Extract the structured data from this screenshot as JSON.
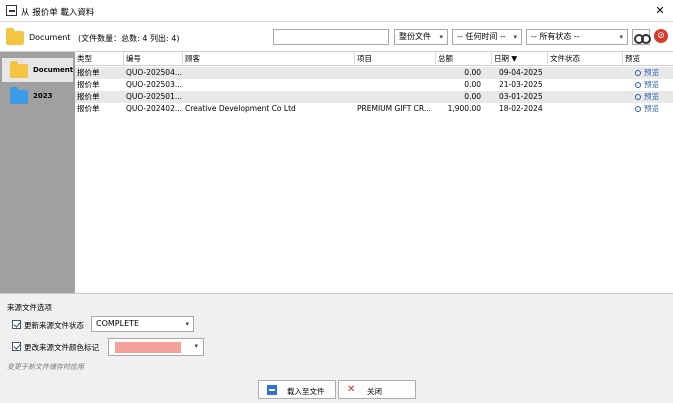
{
  "window": {
    "title": "从 报价单 載入資料",
    "close": "✕"
  },
  "toolbar": {
    "folder_label": "Document",
    "count_text": "(文件数量：总数: 4  列出: 4)",
    "search_value": "",
    "filter_type": "整份文件",
    "filter_time": "-- 任何时间 --",
    "filter_status": "-- 所有状态 --",
    "clear_label": "⊘"
  },
  "sidebar": {
    "items": [
      {
        "label": "Document"
      },
      {
        "label": "2023"
      }
    ]
  },
  "table": {
    "headers": [
      "类型",
      "编号",
      "顾客",
      "项目",
      "总额",
      "日期 ▼",
      "文件状态",
      "预览"
    ],
    "rows": [
      [
        "报价单",
        "QUO-202504...",
        "",
        "",
        "0.00",
        "09-04-2025",
        "",
        "预览"
      ],
      [
        "报价单",
        "QUO-202503...",
        "",
        "",
        "0.00",
        "21-03-2025",
        "",
        "预览"
      ],
      [
        "报价单",
        "QUO-202501...",
        "",
        "",
        "0.00",
        "03-01-2025",
        "",
        "预览"
      ],
      [
        "报价单",
        "QUO-202402...",
        "Creative Development Co Ltd",
        "PREMIUM GIFT CR...",
        "1,900.00",
        "18-02-2024",
        "",
        "预览"
      ]
    ]
  },
  "options": {
    "title": "来源文件选项",
    "update_status_label": "更新来源文件状态",
    "status_value": "COMPLETE",
    "change_color_label": "更改来源文件颜色标记",
    "color_value": "#f6a19b",
    "note": "变更于新文件储存时应用"
  },
  "buttons": {
    "load": "载入至文件",
    "close": "关闭"
  },
  "colors": {
    "folder_active": "#f4c542",
    "folder_blue": "#3c9be8",
    "sidebar_bg": "#a0a0a0",
    "accent": "#2b5fb3"
  }
}
